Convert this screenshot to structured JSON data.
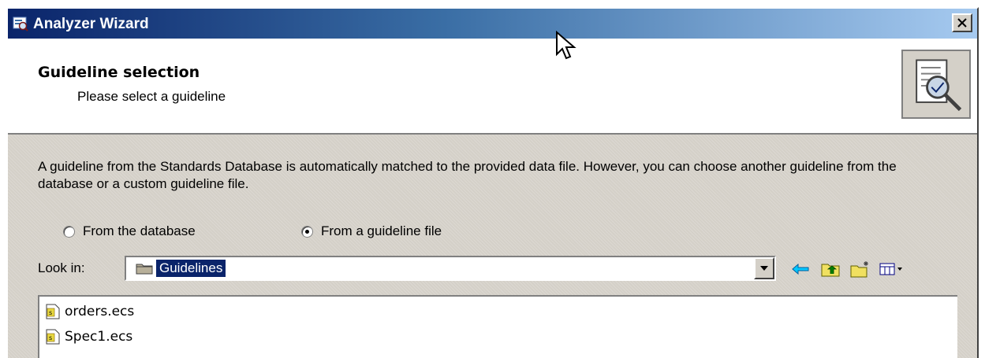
{
  "window": {
    "title": "Analyzer Wizard",
    "close_label": "✕"
  },
  "header": {
    "title": "Guideline selection",
    "subtitle": "Please select a guideline"
  },
  "body": {
    "description": "A guideline from the Standards Database is automatically matched to the provided data file. However, you can choose another guideline from the database or a custom guideline file.",
    "radio_database": {
      "label": "From the database",
      "checked": false
    },
    "radio_file": {
      "label": "From a guideline file",
      "checked": true
    },
    "lookin": {
      "label": "Look in:",
      "value": "Guidelines"
    },
    "toolbar": [
      "back-icon",
      "up-folder-icon",
      "new-folder-icon",
      "view-menu-icon"
    ],
    "files": [
      "orders.ecs",
      "Spec1.ecs"
    ]
  },
  "colors": {
    "titlebar_start": "#0a246a",
    "titlebar_end": "#a6caf0",
    "selection": "#0a246a",
    "face": "#d4d0c8"
  }
}
